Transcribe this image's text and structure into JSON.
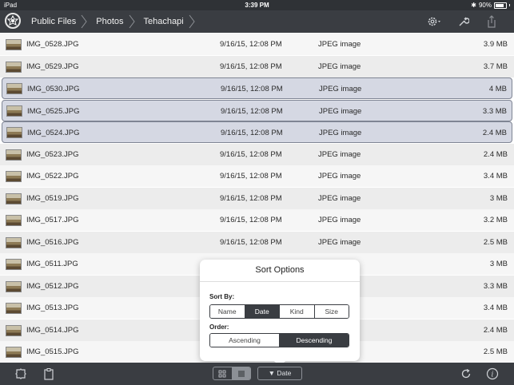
{
  "status_bar": {
    "device": "iPad",
    "time": "3:39 PM",
    "battery": "90%"
  },
  "navbar": {
    "breadcrumbs": [
      "Public Files",
      "Photos",
      "Tehachapi"
    ],
    "icons": [
      "app-logo-icon",
      "gear-icon",
      "wrench-icon",
      "share-icon"
    ]
  },
  "files": [
    {
      "name": "IMG_0528.JPG",
      "date": "9/16/15, 12:08 PM",
      "type": "JPEG image",
      "size": "3.9 MB",
      "selected": false
    },
    {
      "name": "IMG_0529.JPG",
      "date": "9/16/15, 12:08 PM",
      "type": "JPEG image",
      "size": "3.7 MB",
      "selected": false
    },
    {
      "name": "IMG_0530.JPG",
      "date": "9/16/15, 12:08 PM",
      "type": "JPEG image",
      "size": "4 MB",
      "selected": true
    },
    {
      "name": "IMG_0525.JPG",
      "date": "9/16/15, 12:08 PM",
      "type": "JPEG image",
      "size": "3.3 MB",
      "selected": true
    },
    {
      "name": "IMG_0524.JPG",
      "date": "9/16/15, 12:08 PM",
      "type": "JPEG image",
      "size": "2.4 MB",
      "selected": true
    },
    {
      "name": "IMG_0523.JPG",
      "date": "9/16/15, 12:08 PM",
      "type": "JPEG image",
      "size": "2.4 MB",
      "selected": false
    },
    {
      "name": "IMG_0522.JPG",
      "date": "9/16/15, 12:08 PM",
      "type": "JPEG image",
      "size": "3.4 MB",
      "selected": false
    },
    {
      "name": "IMG_0519.JPG",
      "date": "9/16/15, 12:08 PM",
      "type": "JPEG image",
      "size": "3 MB",
      "selected": false
    },
    {
      "name": "IMG_0517.JPG",
      "date": "9/16/15, 12:08 PM",
      "type": "JPEG image",
      "size": "3.2 MB",
      "selected": false
    },
    {
      "name": "IMG_0516.JPG",
      "date": "9/16/15, 12:08 PM",
      "type": "JPEG image",
      "size": "2.5 MB",
      "selected": false
    },
    {
      "name": "IMG_0511.JPG",
      "date": "",
      "type": "",
      "size": "3 MB",
      "selected": false
    },
    {
      "name": "IMG_0512.JPG",
      "date": "",
      "type": "",
      "size": "3.3 MB",
      "selected": false
    },
    {
      "name": "IMG_0513.JPG",
      "date": "",
      "type": "",
      "size": "3.4 MB",
      "selected": false
    },
    {
      "name": "IMG_0514.JPG",
      "date": "",
      "type": "",
      "size": "2.4 MB",
      "selected": false
    },
    {
      "name": "IMG_0515.JPG",
      "date": "",
      "type": "",
      "size": "2.5 MB",
      "selected": false
    }
  ],
  "sort_popover": {
    "title": "Sort Options",
    "sort_by_label": "Sort By:",
    "sort_by_options": [
      "Name",
      "Date",
      "Kind",
      "Size"
    ],
    "sort_by_selected": "Date",
    "order_label": "Order:",
    "order_options": [
      "Ascending",
      "Descending"
    ],
    "order_selected": "Descending"
  },
  "toolbar": {
    "sort_button_label": "▼ Date",
    "view_modes": [
      "grid-view-icon",
      "list-view-icon"
    ],
    "view_selected": "list-view-icon",
    "icons": [
      "puzzle-icon",
      "clipboard-icon",
      "refresh-icon",
      "info-icon"
    ]
  },
  "colors": {
    "bar": "#3a3d42",
    "selected_row": "#d5d8e3"
  }
}
